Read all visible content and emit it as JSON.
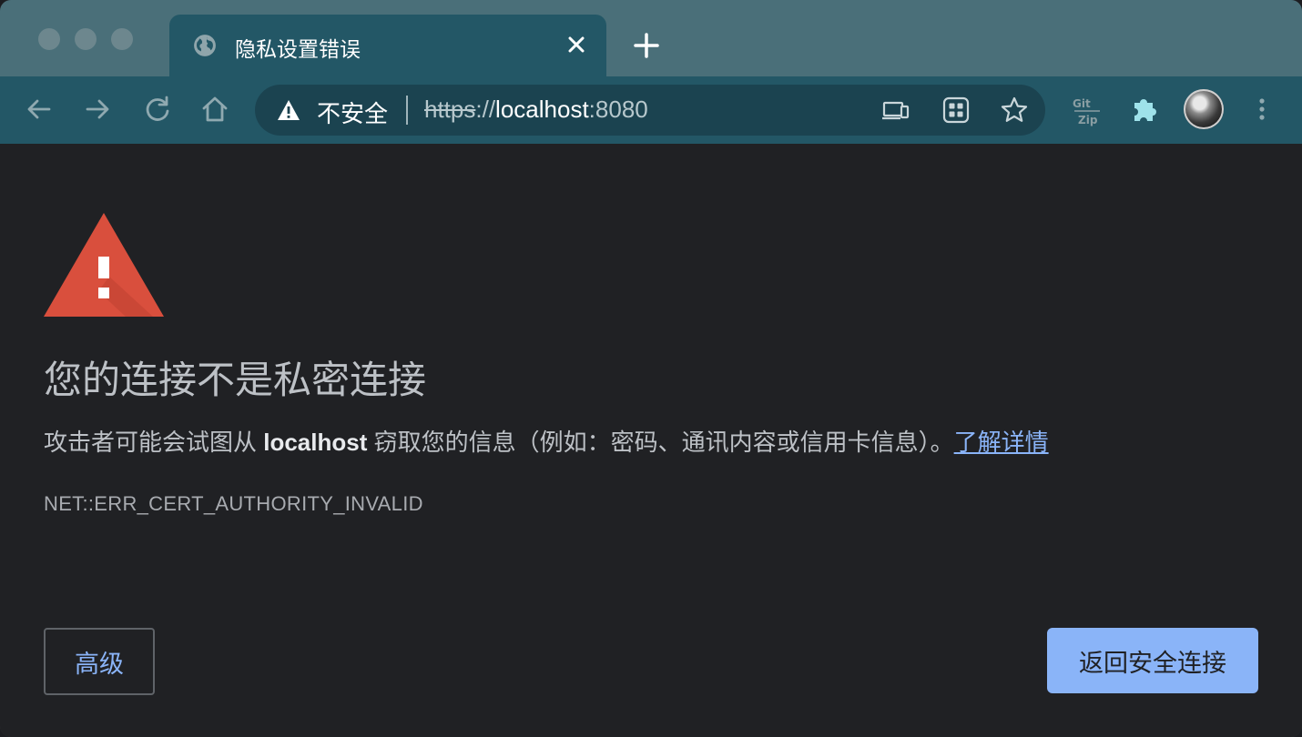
{
  "tab": {
    "title": "隐私设置错误",
    "favicon": "globe-icon",
    "close_icon": "close-icon",
    "new_tab_icon": "plus-icon"
  },
  "toolbar": {
    "back_icon": "arrow-left-icon",
    "forward_icon": "arrow-right-icon",
    "reload_icon": "reload-icon",
    "home_icon": "home-icon",
    "security_label": "不安全",
    "url_scheme": "https",
    "url_separator": "://",
    "url_host": "localhost",
    "url_port": ":8080",
    "omnibox_icons": [
      "cast-device-icon",
      "apps-grid-icon",
      "star-icon"
    ],
    "extensions": [
      "gitzip-icon",
      "puzzle-icon"
    ],
    "profile": "avatar",
    "menu_icon": "kebab-menu-icon"
  },
  "page": {
    "heading": "您的连接不是私密连接",
    "desc_before": "攻击者可能会试图从 ",
    "desc_host": "localhost",
    "desc_after": " 窃取您的信息（例如：密码、通讯内容或信用卡信息）。",
    "learn_more": "了解详情",
    "error_code": "NET::ERR_CERT_AUTHORITY_INVALID",
    "advanced_button": "高级",
    "back_button": "返回安全连接"
  },
  "colors": {
    "tabstrip": "#4a6f79",
    "toolbar": "#235766",
    "content_bg": "#202124",
    "warning_red": "#d94f3d",
    "link": "#8ab4f8",
    "primary_button": "#8ab4f8"
  }
}
